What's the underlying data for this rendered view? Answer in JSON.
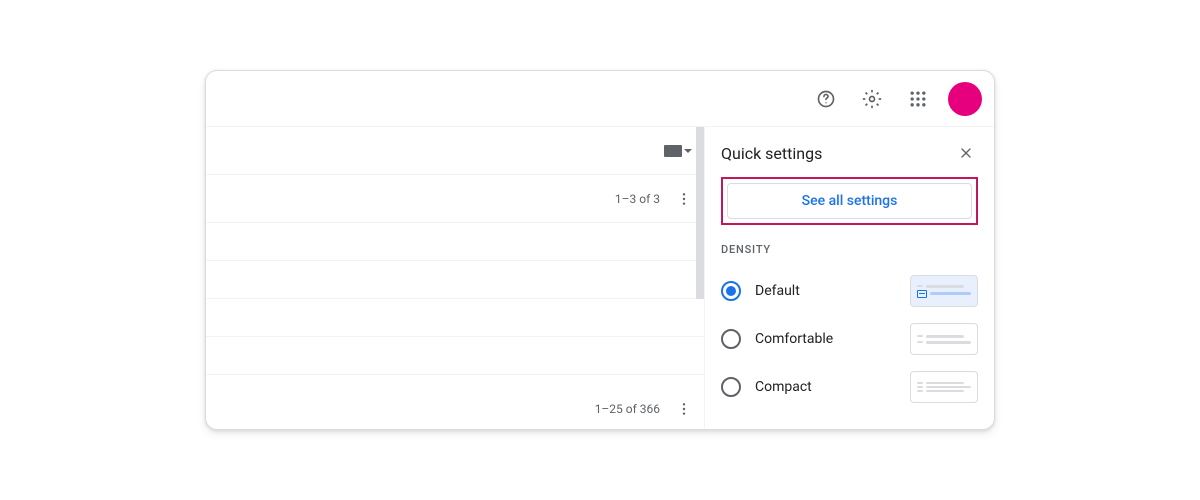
{
  "topbar": {
    "help_icon": "help",
    "settings_icon": "settings",
    "apps_icon": "apps"
  },
  "main": {
    "pagination_top": "1–3 of 3",
    "pagination_bottom": "1–25 of 366"
  },
  "settings": {
    "title": "Quick settings",
    "see_all_label": "See all settings",
    "density_heading": "DENSITY",
    "options": [
      {
        "label": "Default",
        "selected": true
      },
      {
        "label": "Comfortable",
        "selected": false
      },
      {
        "label": "Compact",
        "selected": false
      }
    ]
  }
}
